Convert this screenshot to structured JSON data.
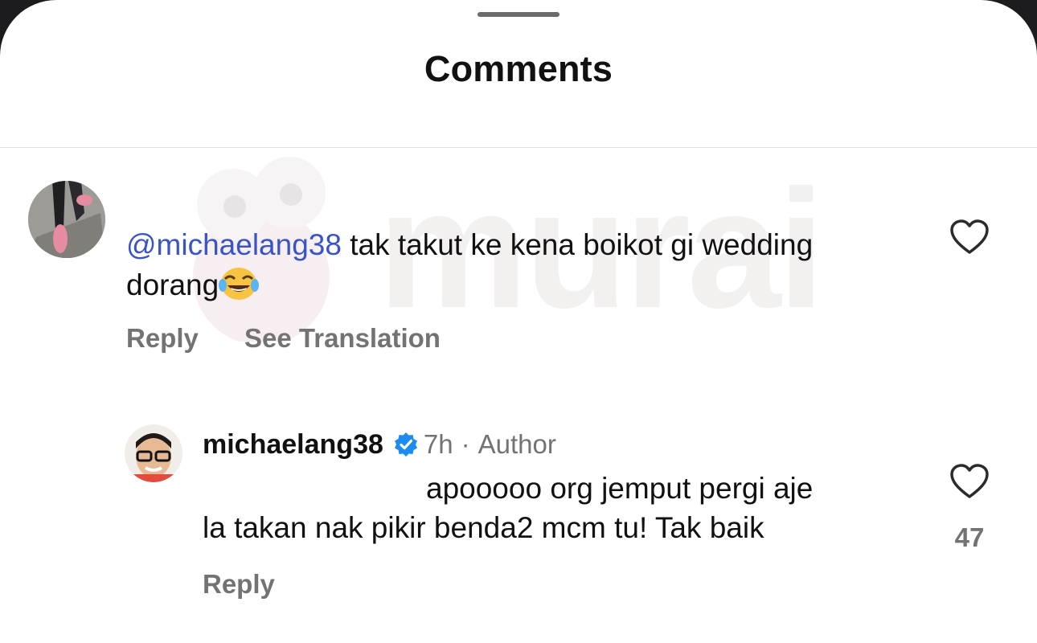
{
  "header": {
    "title": "Comments"
  },
  "watermark": {
    "text": "murai"
  },
  "comments": [
    {
      "mention": "@michaelang38",
      "text": " tak takut ke kena boikot gi wedding dorang",
      "emoji": "face-with-tears-of-joy",
      "reply_label": "Reply",
      "translate_label": "See Translation"
    },
    {
      "username": "michaelang38",
      "verified": true,
      "time": "7h",
      "separator": "·",
      "role": "Author",
      "line1": "apooooo org jemput pergi aje",
      "line2": "la takan nak pikir benda2 mcm tu! Tak baik",
      "likes": "47",
      "reply_label": "Reply"
    }
  ],
  "colors": {
    "mention": "#3a54c6",
    "muted": "#737373",
    "verified": "#1d8cf0"
  }
}
